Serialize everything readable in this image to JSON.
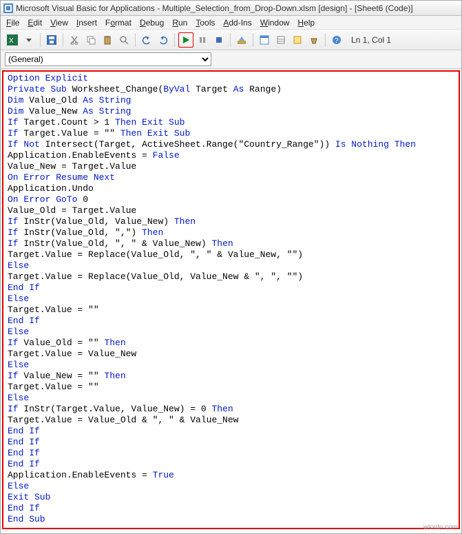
{
  "title": "Microsoft Visual Basic for Applications - Multiple_Selection_from_Drop-Down.xlsm [design] - [Sheet6 (Code)]",
  "menu": {
    "file": "File",
    "edit": "Edit",
    "view": "View",
    "insert": "Insert",
    "format": "Format",
    "debug": "Debug",
    "run": "Run",
    "tools": "Tools",
    "addins": "Add-Ins",
    "window": "Window",
    "help": "Help"
  },
  "toolbar": {
    "position": "Ln 1, Col 1"
  },
  "dropdown": {
    "general": "(General)"
  },
  "code_lines": [
    [
      [
        "Option",
        "kw"
      ],
      [
        " Explicit",
        "kw"
      ]
    ],
    [
      [
        "Private Sub",
        "kw"
      ],
      [
        " Worksheet_Change(",
        ""
      ],
      [
        "ByVal",
        "kw"
      ],
      [
        " Target ",
        ""
      ],
      [
        "As",
        "kw"
      ],
      [
        " Range)",
        ""
      ]
    ],
    [
      [
        "Dim",
        "kw"
      ],
      [
        " Value_Old ",
        ""
      ],
      [
        "As String",
        "kw"
      ]
    ],
    [
      [
        "Dim",
        "kw"
      ],
      [
        " Value_New ",
        ""
      ],
      [
        "As String",
        "kw"
      ]
    ],
    [
      [
        "If",
        "kw"
      ],
      [
        " Target.Count > 1 ",
        ""
      ],
      [
        "Then Exit Sub",
        "kw"
      ]
    ],
    [
      [
        "If",
        "kw"
      ],
      [
        " Target.Value = \"\" ",
        ""
      ],
      [
        "Then Exit Sub",
        "kw"
      ]
    ],
    [
      [
        "If Not",
        "kw"
      ],
      [
        " Intersect(Target, ActiveSheet.Range(\"Country_Range\")) ",
        ""
      ],
      [
        "Is Nothing Then",
        "kw"
      ]
    ],
    [
      [
        "Application.EnableEvents = ",
        ""
      ],
      [
        "False",
        "kw"
      ]
    ],
    [
      [
        "Value_New = Target.Value",
        ""
      ]
    ],
    [
      [
        "On Error Resume Next",
        "kw"
      ]
    ],
    [
      [
        "Application.Undo",
        ""
      ]
    ],
    [
      [
        "On Error GoTo",
        "kw"
      ],
      [
        " 0",
        ""
      ]
    ],
    [
      [
        "Value_Old = Target.Value",
        ""
      ]
    ],
    [
      [
        "If",
        "kw"
      ],
      [
        " InStr(Value_Old, Value_New) ",
        ""
      ],
      [
        "Then",
        "kw"
      ]
    ],
    [
      [
        "If",
        "kw"
      ],
      [
        " InStr(Value_Old, \",\") ",
        ""
      ],
      [
        "Then",
        "kw"
      ]
    ],
    [
      [
        "If",
        "kw"
      ],
      [
        " InStr(Value_Old, \", \" & Value_New) ",
        ""
      ],
      [
        "Then",
        "kw"
      ]
    ],
    [
      [
        "Target.Value = Replace(Value_Old, \", \" & Value_New, \"\")",
        ""
      ]
    ],
    [
      [
        "Else",
        "kw"
      ]
    ],
    [
      [
        "Target.Value = Replace(Value_Old, Value_New & \", \", \"\")",
        ""
      ]
    ],
    [
      [
        "End If",
        "kw"
      ]
    ],
    [
      [
        "Else",
        "kw"
      ]
    ],
    [
      [
        "Target.Value = \"\"",
        ""
      ]
    ],
    [
      [
        "End If",
        "kw"
      ]
    ],
    [
      [
        "Else",
        "kw"
      ]
    ],
    [
      [
        "If",
        "kw"
      ],
      [
        " Value_Old = \"\" ",
        ""
      ],
      [
        "Then",
        "kw"
      ]
    ],
    [
      [
        "Target.Value = Value_New",
        ""
      ]
    ],
    [
      [
        "Else",
        "kw"
      ]
    ],
    [
      [
        "If",
        "kw"
      ],
      [
        " Value_New = \"\" ",
        ""
      ],
      [
        "Then",
        "kw"
      ]
    ],
    [
      [
        "Target.Value = \"\"",
        ""
      ]
    ],
    [
      [
        "Else",
        "kw"
      ]
    ],
    [
      [
        "If",
        "kw"
      ],
      [
        " InStr(Target.Value, Value_New) = 0 ",
        ""
      ],
      [
        "Then",
        "kw"
      ]
    ],
    [
      [
        "Target.Value = Value_Old & \", \" & Value_New",
        ""
      ]
    ],
    [
      [
        "End If",
        "kw"
      ]
    ],
    [
      [
        "End If",
        "kw"
      ]
    ],
    [
      [
        "End If",
        "kw"
      ]
    ],
    [
      [
        "End If",
        "kw"
      ]
    ],
    [
      [
        "Application.EnableEvents = ",
        ""
      ],
      [
        "True",
        "kw"
      ]
    ],
    [
      [
        "Else",
        "kw"
      ]
    ],
    [
      [
        "Exit Sub",
        "kw"
      ]
    ],
    [
      [
        "End If",
        "kw"
      ]
    ],
    [
      [
        "End Sub",
        "kw"
      ]
    ]
  ],
  "watermark": "wsxdn.com"
}
